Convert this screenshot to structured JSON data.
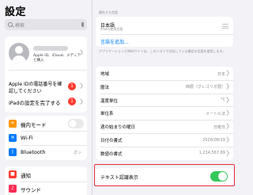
{
  "sidebar": {
    "title": "設定",
    "search_placeholder": "検索",
    "profile": {
      "subtitle": "Apple ID、iCloud、メディアと購入",
      "apple_id_notice": "Apple IDの電話番号を確認してください",
      "apple_id_badge": "1"
    },
    "finish_setup": {
      "label": "iPadの設定を完了する",
      "badge": "1"
    },
    "network": [
      {
        "icon": "airplane-icon",
        "label": "機内モード",
        "color": "#ff9500",
        "glyph": "✈"
      },
      {
        "icon": "wifi-icon",
        "label": "Wi-Fi",
        "color": "#007aff",
        "glyph": "≋"
      },
      {
        "icon": "bluetooth-icon",
        "label": "Bluetooth",
        "value": "オン",
        "color": "#007aff",
        "glyph": "ᛒ"
      }
    ],
    "notifications": [
      {
        "icon": "notification-icon",
        "label": "通知",
        "color": "#ff3b30",
        "glyph": "■"
      },
      {
        "icon": "sound-icon",
        "label": "サウンド",
        "color": "#ff2d55",
        "glyph": "♪"
      }
    ]
  },
  "detail": {
    "preferred_languages_header": "優先する言語",
    "language": {
      "name": "日本語",
      "native": "iPadの使用言語"
    },
    "add_language": "言語を追加...",
    "languages_footnote": "アプリケーションとWebサイトは、このリストで対応している最初の言語を使用します。",
    "region_rows": [
      {
        "label": "地域",
        "value": "日本"
      },
      {
        "label": "暦法",
        "value": "西暦（グレゴリオ暦）"
      },
      {
        "label": "温度単位",
        "value": "°C"
      },
      {
        "label": "単位系",
        "value": "メートル法"
      },
      {
        "label": "週の始まりの曜日",
        "value": "日曜日"
      },
      {
        "label": "日付の書式",
        "value": "2026/08/19"
      },
      {
        "label": "数値の書式",
        "value": "1,234,567.89"
      }
    ],
    "live_text": {
      "label": "テキスト認識表示",
      "enabled": true
    }
  },
  "colors": {
    "accent": "#007aff",
    "toggle_on": "#34c759",
    "highlight": "#e8313a"
  }
}
